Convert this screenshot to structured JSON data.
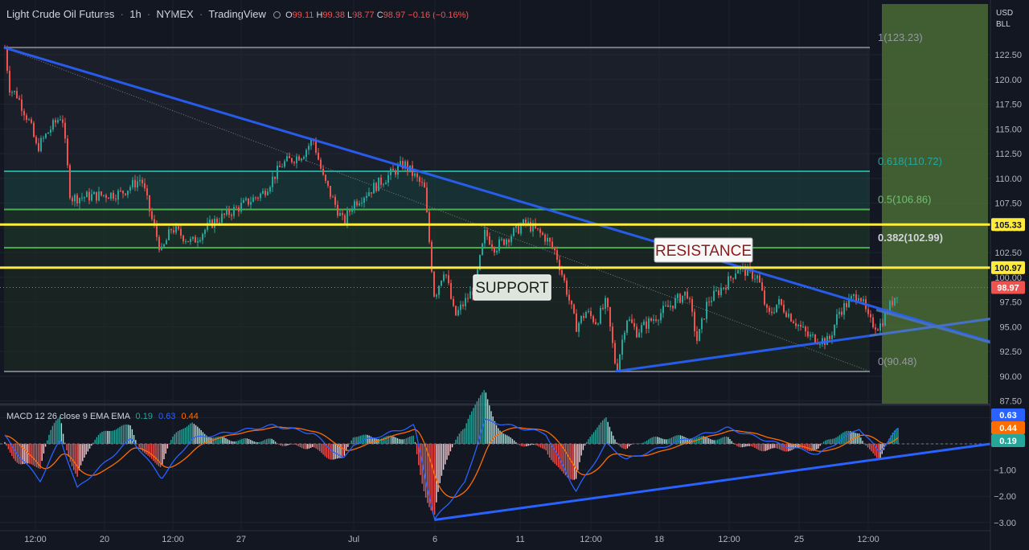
{
  "header": {
    "symbol": "Light Crude Oil Futures",
    "interval": "1h",
    "exchange": "NYMEX",
    "source": "TradingView",
    "open_label": "O",
    "open": "99.11",
    "high_label": "H",
    "high": "99.38",
    "low_label": "L",
    "low": "98.77",
    "close_label": "C",
    "close": "98.97",
    "change": "−0.16 (−0.16%)"
  },
  "price_axis": {
    "currency": "USD",
    "unit": "BLL",
    "ticks": [
      "122.50",
      "120.00",
      "117.50",
      "115.00",
      "112.50",
      "110.00",
      "107.50",
      "105.00",
      "102.50",
      "100.00",
      "97.50",
      "95.00",
      "92.50",
      "90.00",
      "87.50"
    ]
  },
  "price_badges": {
    "resistance_level": "105.33",
    "support_level": "100.97",
    "last_price": "98.97"
  },
  "fibonacci": [
    {
      "label": "1(123.23)",
      "ratio": 1,
      "price": 123.23
    },
    {
      "label": "0.618(110.72)",
      "ratio": 0.618,
      "price": 110.72
    },
    {
      "label": "0.5(106.86)",
      "ratio": 0.5,
      "price": 106.86
    },
    {
      "label": "0.382(102.99)",
      "ratio": 0.382,
      "price": 102.99
    },
    {
      "label": "0(90.48)",
      "ratio": 0,
      "price": 90.48
    }
  ],
  "annotations": {
    "resistance": "RESISTANCE",
    "support": "SUPPORT"
  },
  "time_axis": {
    "ticks": [
      "12:00",
      "20",
      "12:00",
      "27",
      "Jul",
      "6",
      "11",
      "12:00",
      "18",
      "12:00",
      "25",
      "12:00"
    ]
  },
  "macd": {
    "title": "MACD",
    "params": "12 26 close 9 EMA EMA",
    "histogram_value": "0.19",
    "macd_value": "0.63",
    "signal_value": "0.44",
    "ticks": [
      "1.00",
      "0.00",
      "−1.00",
      "−2.00",
      "−3.00"
    ]
  },
  "colors": {
    "background": "#131722",
    "up": "#26a69a",
    "down": "#ef5350",
    "trendline": "#2962ff",
    "sr_line": "#ffeb3b",
    "fib_618": "#26a69a",
    "fib_50": "#4caf50",
    "fib_382": "#4caf50",
    "fib_bounds": "#787b86",
    "projection_zone": "#4a6b35",
    "macd_line": "#2962ff",
    "signal_line": "#ff6d00",
    "resistance_text": "#8b1a1a"
  },
  "chart_data": {
    "type": "candlestick",
    "title": "Light Crude Oil Futures · 1h · NYMEX",
    "ylabel": "USD / BLL",
    "ylim": [
      87.5,
      124.5
    ],
    "grid": true,
    "close_path": [
      {
        "x": "Jun 14 06:00",
        "y": 123.2
      },
      {
        "x": "Jun 14 12:00",
        "y": 119.0
      },
      {
        "x": "Jun 14 20:00",
        "y": 118.5
      },
      {
        "x": "Jun 15 12:00",
        "y": 115.5
      },
      {
        "x": "Jun 15 20:00",
        "y": 113.0
      },
      {
        "x": "Jun 16 12:00",
        "y": 115.0
      },
      {
        "x": "Jun 17 02:00",
        "y": 116.5
      },
      {
        "x": "Jun 17 12:00",
        "y": 108.0
      },
      {
        "x": "Jun 20 00:00",
        "y": 108.5
      },
      {
        "x": "Jun 21 00:00",
        "y": 110.0
      },
      {
        "x": "Jun 21 12:00",
        "y": 106.0
      },
      {
        "x": "Jun 22 00:00",
        "y": 102.5
      },
      {
        "x": "Jun 22 12:00",
        "y": 105.0
      },
      {
        "x": "Jun 23 12:00",
        "y": 103.5
      },
      {
        "x": "Jun 24 12:00",
        "y": 105.5
      },
      {
        "x": "Jun 27 00:00",
        "y": 108.5
      },
      {
        "x": "Jun 28 00:00",
        "y": 111.5
      },
      {
        "x": "Jun 29 00:00",
        "y": 112.5
      },
      {
        "x": "Jun 29 12:00",
        "y": 114.0
      },
      {
        "x": "Jun 30 00:00",
        "y": 110.0
      },
      {
        "x": "Jul 01 00:00",
        "y": 105.5
      },
      {
        "x": "Jul 01 12:00",
        "y": 107.5
      },
      {
        "x": "Jul 04 00:00",
        "y": 111.5
      },
      {
        "x": "Jul 05 00:00",
        "y": 109.0
      },
      {
        "x": "Jul 05 12:00",
        "y": 98.0
      },
      {
        "x": "Jul 06 00:00",
        "y": 101.0
      },
      {
        "x": "Jul 06 12:00",
        "y": 96.0
      },
      {
        "x": "Jul 07 12:00",
        "y": 99.0
      },
      {
        "x": "Jul 08 00:00",
        "y": 104.5
      },
      {
        "x": "Jul 08 12:00",
        "y": 103.0
      },
      {
        "x": "Jul 10 00:00",
        "y": 105.5
      },
      {
        "x": "Jul 11 00:00",
        "y": 104.0
      },
      {
        "x": "Jul 11 12:00",
        "y": 102.5
      },
      {
        "x": "Jul 12 00:00",
        "y": 99.0
      },
      {
        "x": "Jul 12 12:00",
        "y": 95.0
      },
      {
        "x": "Jul 13 00:00",
        "y": 96.5
      },
      {
        "x": "Jul 13 12:00",
        "y": 95.5
      },
      {
        "x": "Jul 14 00:00",
        "y": 97.5
      },
      {
        "x": "Jul 14 12:00",
        "y": 90.5
      },
      {
        "x": "Jul 15 00:00",
        "y": 96.0
      },
      {
        "x": "Jul 15 12:00",
        "y": 94.5
      },
      {
        "x": "Jul 18 00:00",
        "y": 98.5
      },
      {
        "x": "Jul 18 12:00",
        "y": 93.5
      },
      {
        "x": "Jul 19 00:00",
        "y": 97.5
      },
      {
        "x": "Jul 20 00:00",
        "y": 99.5
      },
      {
        "x": "Jul 20 12:00",
        "y": 101.0
      },
      {
        "x": "Jul 21 12:00",
        "y": 100.0
      },
      {
        "x": "Jul 22 00:00",
        "y": 96.0
      },
      {
        "x": "Jul 22 12:00",
        "y": 97.5
      },
      {
        "x": "Jul 24 00:00",
        "y": 94.0
      },
      {
        "x": "Jul 25 00:00",
        "y": 93.5
      },
      {
        "x": "Jul 25 12:00",
        "y": 96.5
      },
      {
        "x": "Jul 26 12:00",
        "y": 98.5
      },
      {
        "x": "Jul 27 00:00",
        "y": 95.5
      },
      {
        "x": "Jul 27 12:00",
        "y": 95.0
      },
      {
        "x": "Jul 28 00:00",
        "y": 97.0
      },
      {
        "x": "Jul 28 12:00",
        "y": 98.97
      }
    ],
    "horizontal_levels": [
      {
        "name": "resistance",
        "y": 105.33
      },
      {
        "name": "support",
        "y": 100.97
      }
    ],
    "trendlines": [
      {
        "name": "descending",
        "from": {
          "x": "Jun 14 06:00",
          "y": 123.2
        },
        "to": {
          "x": "Aug 02",
          "y": 93.5
        }
      },
      {
        "name": "ascending",
        "from": {
          "x": "Jul 14 12:00",
          "y": 90.5
        },
        "to": {
          "x": "Aug 02",
          "y": 95.8
        }
      }
    ],
    "macd_path": [
      {
        "x": "Jun 14 06:00",
        "y": 0.3
      },
      {
        "x": "Jun 15 00:00",
        "y": -0.5
      },
      {
        "x": "Jun 16 00:00",
        "y": -1.4
      },
      {
        "x": "Jun 17 00:00",
        "y": 0.2
      },
      {
        "x": "Jun 17 20:00",
        "y": -1.7
      },
      {
        "x": "Jun 20 12:00",
        "y": 0.2
      },
      {
        "x": "Jun 22 00:00",
        "y": -1.3
      },
      {
        "x": "Jun 23 12:00",
        "y": 0.2
      },
      {
        "x": "Jun 27 12:00",
        "y": 0.7
      },
      {
        "x": "Jun 29 12:00",
        "y": 0.4
      },
      {
        "x": "Jul 01 00:00",
        "y": -0.6
      },
      {
        "x": "Jul 01 12:00",
        "y": 0.0
      },
      {
        "x": "Jul 04 12:00",
        "y": 0.7
      },
      {
        "x": "Jul 05 12:00",
        "y": -2.9
      },
      {
        "x": "Jul 07 00:00",
        "y": -1.5
      },
      {
        "x": "Jul 08 00:00",
        "y": 0.9
      },
      {
        "x": "Jul 11 00:00",
        "y": 0.4
      },
      {
        "x": "Jul 12 12:00",
        "y": -1.8
      },
      {
        "x": "Jul 14 00:00",
        "y": 0.0
      },
      {
        "x": "Jul 15 00:00",
        "y": -0.6
      },
      {
        "x": "Jul 18 00:00",
        "y": 0.2
      },
      {
        "x": "Jul 20 00:00",
        "y": 0.6
      },
      {
        "x": "Jul 22 12:00",
        "y": 0.0
      },
      {
        "x": "Jul 24 12:00",
        "y": -0.4
      },
      {
        "x": "Jul 26 12:00",
        "y": 0.6
      },
      {
        "x": "Jul 27 12:00",
        "y": -0.3
      },
      {
        "x": "Jul 28 12:00",
        "y": 0.63
      }
    ]
  }
}
